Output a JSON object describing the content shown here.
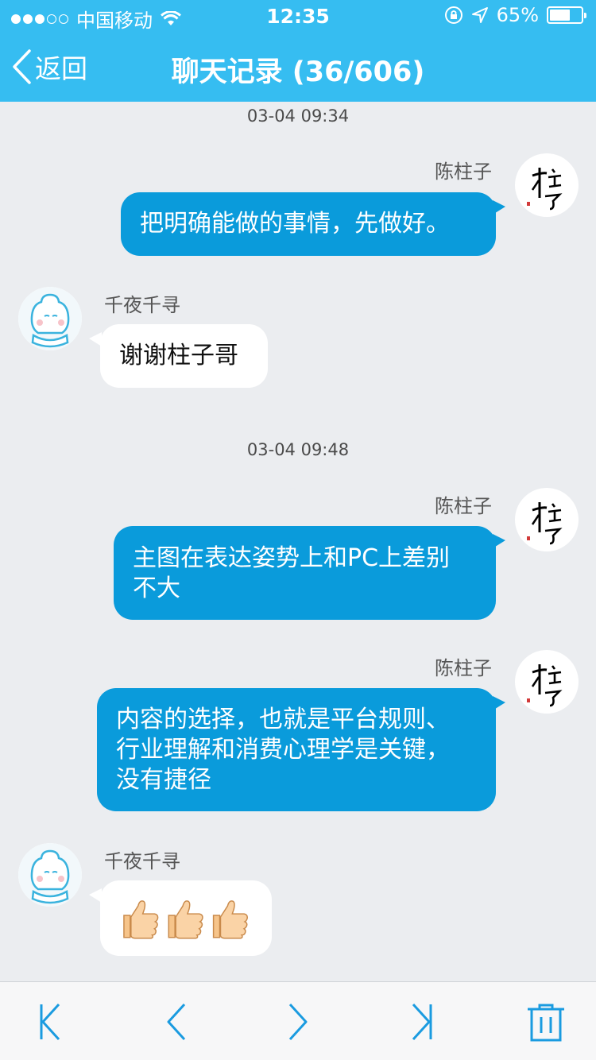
{
  "status_bar": {
    "carrier": "中国移动",
    "time": "12:35",
    "battery": "65%",
    "battery_level": 0.65
  },
  "nav": {
    "back_label": "返回",
    "title": "聊天记录 (36/606)"
  },
  "timestamps": [
    "03-04 09:34",
    "03-04 09:48"
  ],
  "messages": [
    {
      "sender": "陈柱子",
      "text": "把明确能做的事情，先做好。"
    },
    {
      "sender": "千夜千寻",
      "text": "谢谢柱子哥"
    },
    {
      "sender": "陈柱子",
      "line1": "主图在表达姿势上和PC上差别",
      "line2": "不大"
    },
    {
      "sender": "陈柱子",
      "line1": "内容的选择，也就是平台规则、",
      "line2": "行业理解和消费心理学是关键，",
      "line3": "没有捷径"
    },
    {
      "sender": "千夜千寻",
      "text": "👍👍👍"
    }
  ],
  "avatar_self_text": "柱子",
  "icons": {
    "back": "chevron-left-icon",
    "first": "skip-first-icon",
    "prev": "chevron-left-icon",
    "next": "chevron-right-icon",
    "last": "skip-last-icon",
    "delete": "trash-icon"
  },
  "colors": {
    "header": "#36BDF1",
    "bubble_out": "#0A9BDB",
    "bubble_in": "#FFFFFF",
    "background": "#EBEDF0",
    "toolbar_icon": "#1A9BE0"
  }
}
